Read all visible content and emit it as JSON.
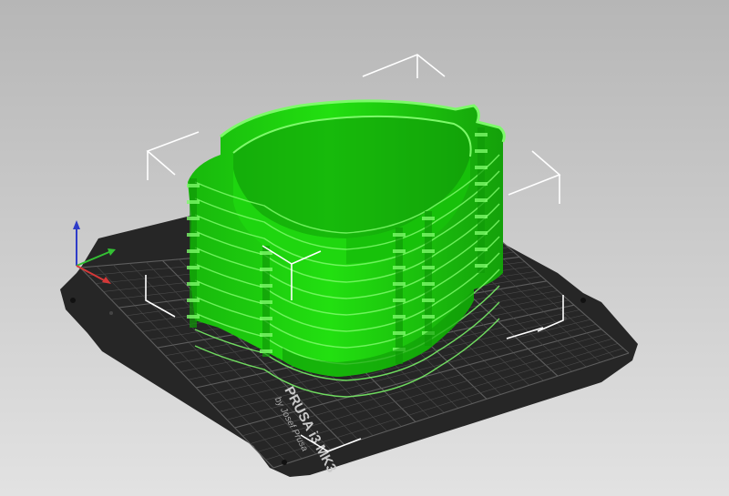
{
  "viewport": {
    "background_top": "#b6b6b6",
    "background_bottom": "#e2e2e2"
  },
  "bed": {
    "fill": "#262626",
    "grid_color": "#4a4a4a",
    "grid_major_color": "#5e5e5e",
    "logo_line1": "PRUSA i3 MK3",
    "logo_line2": "by Josef Prusa"
  },
  "model": {
    "color": "#1fd60f",
    "highlight": "#7dfa6a",
    "shadow": "#0f9a07",
    "layer_lines": 11
  },
  "gizmo": {
    "bbox_corner_color": "#ffffff",
    "axis_x_color": "#d43838",
    "axis_y_color": "#34c034",
    "axis_z_color": "#2e3cc8"
  }
}
